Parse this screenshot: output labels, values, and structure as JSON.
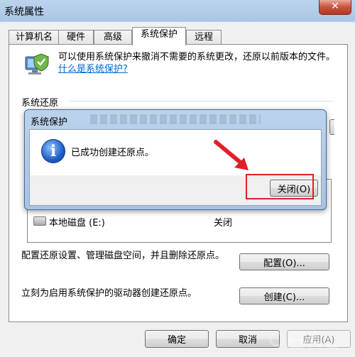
{
  "window": {
    "title": "系统属性",
    "close_glyph": "✕"
  },
  "tabs": [
    {
      "label": "计算机名"
    },
    {
      "label": "硬件"
    },
    {
      "label": "高级"
    },
    {
      "label": "系统保护"
    },
    {
      "label": "远程"
    }
  ],
  "active_tab": "系统保护",
  "intro": {
    "text": "可以使用系统保护来撤消不需要的系统更改，还原以前版本的文件。",
    "link": "什么是系统保护?"
  },
  "restore_section": {
    "title": "系统还原"
  },
  "drives": [
    {
      "name": "本地磁盘 (E:)",
      "status": "关闭"
    }
  ],
  "configure": {
    "text": "配置还原设置、管理磁盘空间，并且删除还原点。",
    "button": "配置(O)..."
  },
  "create": {
    "text": "立刻为启用系统保护的驱动器创建还原点。",
    "button": "创建(C)..."
  },
  "footer": {
    "ok": "确定",
    "cancel": "取消",
    "apply": "应用(A)"
  },
  "dialog": {
    "title": "系统保护",
    "message": "已成功创建还原点。",
    "close_button": "关闭(O)",
    "icon": "info-icon"
  },
  "colors": {
    "highlight": "#e0202a",
    "link": "#0066cc",
    "title_bar": "#bcd3ec"
  }
}
